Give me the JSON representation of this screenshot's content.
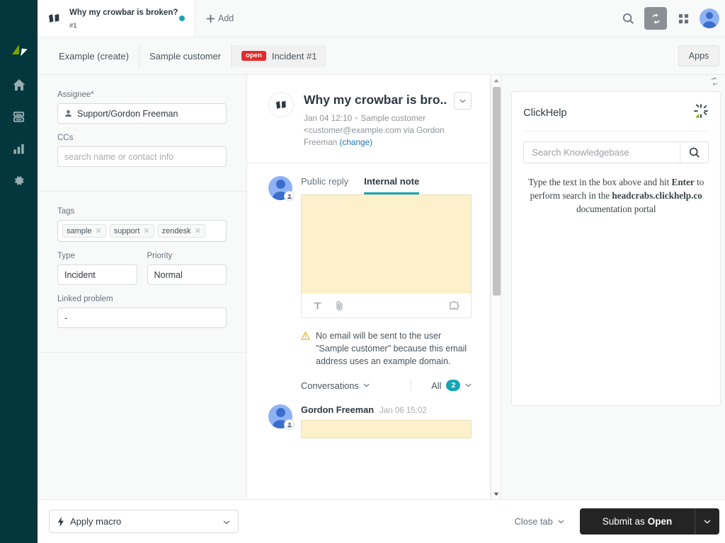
{
  "nav": {
    "logo": "zendesk-logo",
    "items": [
      {
        "name": "home",
        "label": "Home"
      },
      {
        "name": "views",
        "label": "Views"
      },
      {
        "name": "reporting",
        "label": "Reporting"
      },
      {
        "name": "admin",
        "label": "Admin"
      }
    ]
  },
  "topbar": {
    "tab": {
      "title": "Why my crowbar is broken?",
      "subtitle": "#1",
      "status_color": "#17a5b5"
    },
    "add_label": "Add",
    "icons": [
      "search-icon",
      "refresh-icon",
      "apps-grid-icon",
      "user-avatar"
    ]
  },
  "breadcrumb": {
    "items": [
      {
        "label": "Example (create)"
      },
      {
        "label": "Sample customer"
      },
      {
        "label": "Incident #1",
        "badge": "open",
        "badge_color": "#e32b2b"
      }
    ],
    "apps_label": "Apps"
  },
  "properties": {
    "assignee": {
      "label": "Assignee*",
      "value": "Support/Gordon Freeman"
    },
    "ccs": {
      "label": "CCs",
      "placeholder": "search name or contact info",
      "value": ""
    },
    "tags": {
      "label": "Tags",
      "items": [
        "sample",
        "support",
        "zendesk"
      ]
    },
    "type": {
      "label": "Type",
      "value": "Incident"
    },
    "priority": {
      "label": "Priority",
      "value": "Normal"
    },
    "linked_problem": {
      "label": "Linked problem",
      "value": "-"
    }
  },
  "ticket": {
    "title": "Why my crowbar is bro..",
    "date": "Jan 04 12:10",
    "requester": "Sample customer",
    "email": "<customer@example.com via",
    "via_agent": "Gordon Freeman",
    "change_link": "(change)"
  },
  "composer": {
    "tabs": [
      {
        "label": "Public reply",
        "active": false
      },
      {
        "label": "Internal note",
        "active": true
      }
    ],
    "editor_value": "",
    "tools": [
      "text-format-icon",
      "attachment-icon",
      "apps-puzzle-icon"
    ]
  },
  "warning": {
    "text": "No email will be sent to the user \"Sample customer\" because this email address uses an example domain."
  },
  "conversations": {
    "label": "Conversations",
    "filter_label": "All",
    "count": "2"
  },
  "comments": [
    {
      "author": "Gordon Freeman",
      "time": "Jan 06 15:02",
      "body": ""
    }
  ],
  "apps_panel": {
    "app_name": "ClickHelp",
    "search_placeholder": "Search Knowledgebase",
    "search_value": "",
    "note_pre": "Type the text in the box above and hit ",
    "note_bold1": "Enter",
    "note_mid": " to perform search in the ",
    "note_bold2": "headcrabs.clickhelp.co",
    "note_post": " documentation portal"
  },
  "actionbar": {
    "macro_label": "Apply macro",
    "close_tab_label": "Close tab",
    "submit_prefix": "Submit as ",
    "submit_state": "Open"
  }
}
